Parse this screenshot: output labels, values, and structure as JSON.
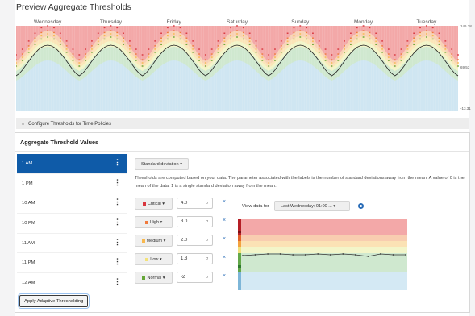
{
  "title": "Preview Aggregate Thresholds",
  "chart": {
    "days": [
      "Wednesday",
      "Thursday",
      "Friday",
      "Saturday",
      "Sunday",
      "Monday",
      "Tuesday"
    ],
    "y_labels": [
      "146.38",
      "69.53",
      "-13.31"
    ],
    "colors": {
      "critical": "#f3a8a8",
      "high": "#f8d2b5",
      "medium": "#fbe5b8",
      "low": "#f2f5c9",
      "normal": "#cfe8cf",
      "info": "#cfe6f2",
      "line": "#222222"
    }
  },
  "config_bar": {
    "label": "Configure Thresholds for Time Policies"
  },
  "section_title": "Aggregate Threshold Values",
  "time_policies": [
    {
      "label": "1 AM",
      "active": true
    },
    {
      "label": "1 PM",
      "active": false
    },
    {
      "label": "10 AM",
      "active": false
    },
    {
      "label": "10 PM",
      "active": false
    },
    {
      "label": "11 AM",
      "active": false
    },
    {
      "label": "11 PM",
      "active": false
    },
    {
      "label": "12 AM",
      "active": false
    }
  ],
  "method_button": "Standard deviation ▾",
  "description": "Thresholds are computed based on your data. The parameter associated with the labels is the number of standard deviations away from the mean. A value of 0 is the mean of the data. 1 is a single standard deviation away from the mean.",
  "thresholds": [
    {
      "severity": "Critical ▾",
      "color": "#d9363e",
      "value": "4.0"
    },
    {
      "severity": "High ▾",
      "color": "#f07a3c",
      "value": "3.0"
    },
    {
      "severity": "Medium ▾",
      "color": "#f8b84e",
      "value": "2.0"
    },
    {
      "severity": "Low ▾",
      "color": "#f3e27a",
      "value": "1.3"
    },
    {
      "severity": "Normal ▾",
      "color": "#65a637",
      "value": "-2"
    }
  ],
  "sigma_glyph": "σ",
  "close_glyph": "×",
  "view_data": {
    "label": "View data for",
    "value": "Last Wednesday: 01:00 ... ▾"
  },
  "apply_button": "Apply Adaptive Thresholding"
}
